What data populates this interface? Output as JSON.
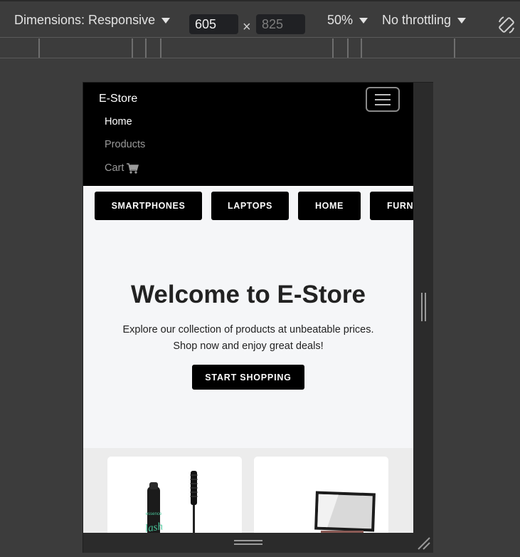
{
  "devtools": {
    "dimensions_label": "Dimensions: Responsive",
    "width_value": "605",
    "height_placeholder": "825",
    "times_symbol": "×",
    "zoom": "50%",
    "throttling": "No throttling"
  },
  "store": {
    "brand": "E-Store",
    "nav": {
      "home": "Home",
      "products": "Products",
      "cart": "Cart"
    },
    "categories": [
      "SMARTPHONES",
      "LAPTOPS",
      "HOME",
      "FURN"
    ],
    "hero": {
      "title": "Welcome to E-Store",
      "line1": "Explore our collection of products at unbeatable prices.",
      "line2": "Shop now and enjoy great deals!",
      "cta": "START SHOPPING"
    },
    "product_card_1_logo": "essence",
    "product_card_1_word": "lash"
  },
  "colors": {
    "navbar_bg": "#000000",
    "page_bg": "#f5f6f8",
    "devtools_bg": "#3c3c3c"
  },
  "icons": {
    "cart": "shopping-cart-icon",
    "rotate": "rotate-icon"
  }
}
